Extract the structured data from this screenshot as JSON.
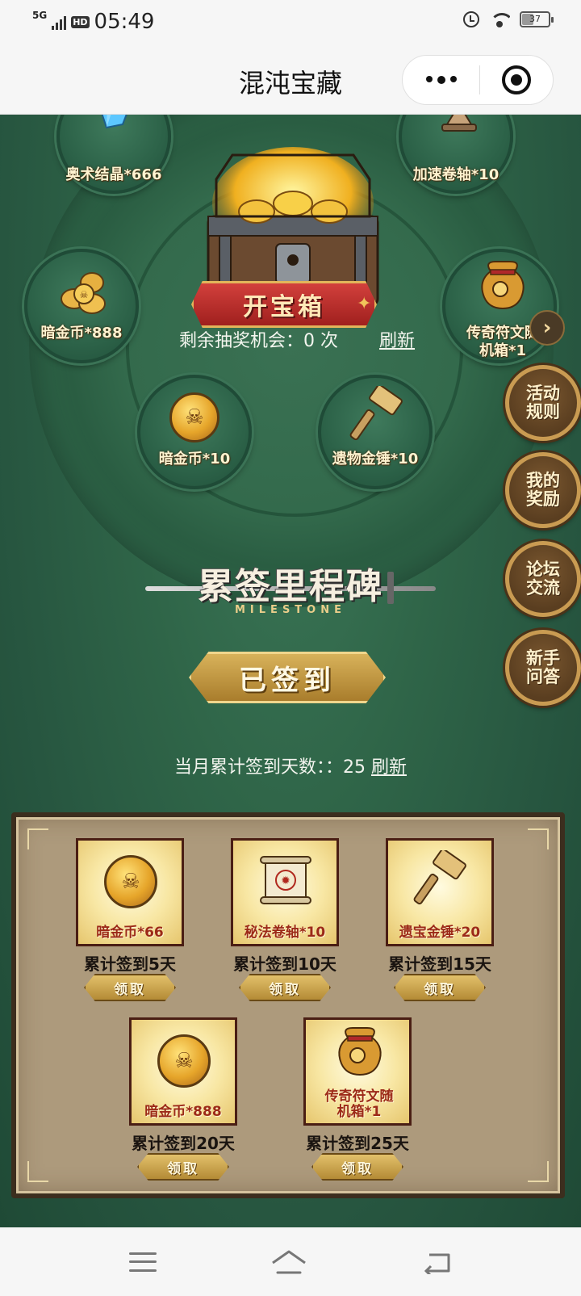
{
  "status": {
    "network": "5G",
    "hd": "HD",
    "time": "05:49",
    "battery": "37"
  },
  "header": {
    "title": "混沌宝藏"
  },
  "wheel": {
    "rewards": [
      {
        "label": "奥术结晶*666",
        "icon": "crystal-icon"
      },
      {
        "label": "加速卷轴*10",
        "icon": "hourglass-icon"
      },
      {
        "label": "暗金币*888",
        "icon": "coin-pile-icon"
      },
      {
        "label": "传奇符文随机箱*1",
        "icon": "rune-bag-icon"
      },
      {
        "label": "暗金币*10",
        "icon": "skull-coin-icon"
      },
      {
        "label": "遗物金锤*10",
        "icon": "hammer-icon"
      }
    ],
    "open_button": "开宝箱",
    "chance_text": "剩余抽奖机会：0 次",
    "refresh": "刷新"
  },
  "side_buttons": [
    "活动规则",
    "我的奖励",
    "论坛交流",
    "新手问答"
  ],
  "milestone": {
    "title": "累签里程碑",
    "subtitle": "MILESTONE",
    "signed_button": "已签到",
    "days_label": "当月累计签到天数：：25",
    "days_refresh": "刷新"
  },
  "cards": [
    {
      "reward": "暗金币*66",
      "day": "累计签到5天",
      "claim": "领取",
      "icon": "skull-coin-icon"
    },
    {
      "reward": "秘法卷轴*10",
      "day": "累计签到10天",
      "claim": "领取",
      "icon": "scroll-icon"
    },
    {
      "reward": "遗宝金锤*20",
      "day": "累计签到15天",
      "claim": "领取",
      "icon": "hammer-icon"
    },
    {
      "reward": "暗金币*888",
      "day": "累计签到20天",
      "claim": "领取",
      "icon": "skull-coin-icon"
    },
    {
      "reward": "传奇符文随机箱*1",
      "day": "累计签到25天",
      "claim": "领取",
      "icon": "rune-bag-icon"
    }
  ],
  "colors": {
    "game_bg": "#2f6548",
    "gold": "#c99b52",
    "red_button": "#b92a26",
    "card_label": "#9c2a18"
  }
}
